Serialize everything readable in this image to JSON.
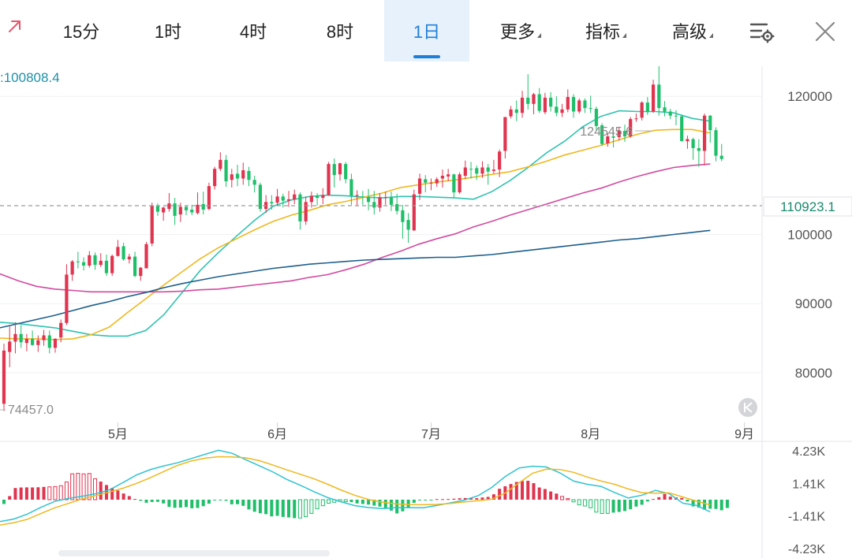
{
  "toolbar": {
    "tabs": [
      {
        "label": "15分",
        "active": false,
        "has_menu": false
      },
      {
        "label": "1时",
        "active": false,
        "has_menu": false
      },
      {
        "label": "4时",
        "active": false,
        "has_menu": false
      },
      {
        "label": "8时",
        "active": false,
        "has_menu": false
      },
      {
        "label": "1日",
        "active": true,
        "has_menu": false
      },
      {
        "label": "更多",
        "active": false,
        "has_menu": true
      },
      {
        "label": "指标",
        "active": false,
        "has_menu": true
      },
      {
        "label": "高级",
        "active": false,
        "has_menu": true
      }
    ],
    "icons": [
      "expand-arrow-icon",
      "chart-settings-icon",
      "close-icon"
    ]
  },
  "colors": {
    "accent": "#1f7fd8",
    "up": "#e0344f",
    "down": "#1fbf6a",
    "ma_teal": "#2fc3b0",
    "ma_yellow": "#f0b81e",
    "ma_pink": "#d24aa0",
    "ma_navy": "#1d5e8c"
  },
  "chart_data": {
    "type": "candlestick",
    "interval": "1日",
    "ma_readout": ":100808.4",
    "price_levels": [
      "120000",
      "100000",
      "90000",
      "80000"
    ],
    "y_range": [
      72800,
      123900
    ],
    "current_price": 110923.1,
    "current_price_label": "110923.1",
    "high_marker": {
      "label": "124545.6",
      "value": 124545.6
    },
    "low_marker": {
      "label": "74457.0",
      "value": 74457
    },
    "x_months": [
      "5月",
      "6月",
      "7月",
      "8月",
      "9月"
    ],
    "candles_ohlc": [
      [
        75500,
        84200,
        74457,
        83200
      ],
      [
        83000,
        86700,
        80800,
        84500
      ],
      [
        84500,
        87300,
        82800,
        85600
      ],
      [
        85600,
        86900,
        83600,
        84400
      ],
      [
        84300,
        85600,
        83100,
        84900
      ],
      [
        84900,
        86100,
        83900,
        84000
      ],
      [
        84000,
        85400,
        83000,
        84700
      ],
      [
        84700,
        86200,
        83900,
        85400
      ],
      [
        85400,
        86100,
        82800,
        83600
      ],
      [
        83600,
        85000,
        82900,
        84900
      ],
      [
        85100,
        87700,
        84400,
        87200
      ],
      [
        87200,
        95700,
        86900,
        94200
      ],
      [
        94200,
        96300,
        93300,
        96100
      ],
      [
        96100,
        97500,
        95100,
        96000
      ],
      [
        96000,
        96700,
        94800,
        95500
      ],
      [
        95500,
        97600,
        95200,
        97000
      ],
      [
        97000,
        97400,
        94900,
        95600
      ],
      [
        95600,
        97300,
        95300,
        96200
      ],
      [
        96200,
        97100,
        94000,
        94400
      ],
      [
        94400,
        97100,
        94000,
        96900
      ],
      [
        96900,
        99200,
        96800,
        98200
      ],
      [
        98300,
        98800,
        96200,
        96400
      ],
      [
        96400,
        97200,
        95800,
        96800
      ],
      [
        96800,
        97500,
        93800,
        94000
      ],
      [
        94000,
        95300,
        93300,
        95200
      ],
      [
        95100,
        98900,
        95100,
        98600
      ],
      [
        98700,
        104600,
        98300,
        104200
      ],
      [
        104200,
        104500,
        102700,
        103300
      ],
      [
        103200,
        104000,
        102000,
        103900
      ],
      [
        103700,
        106000,
        103300,
        104500
      ],
      [
        104500,
        105300,
        101400,
        102700
      ],
      [
        102900,
        104600,
        101800,
        104000
      ],
      [
        104000,
        104200,
        102800,
        103500
      ],
      [
        103600,
        104300,
        102800,
        103200
      ],
      [
        103100,
        106100,
        102900,
        104300
      ],
      [
        104400,
        106200,
        102900,
        103600
      ],
      [
        103700,
        107500,
        103500,
        107000
      ],
      [
        107000,
        109800,
        106500,
        109500
      ],
      [
        109500,
        111900,
        109200,
        110800
      ],
      [
        110800,
        111500,
        106900,
        107700
      ],
      [
        107900,
        109500,
        106800,
        108700
      ],
      [
        108800,
        110100,
        107000,
        108100
      ],
      [
        108100,
        110400,
        107200,
        109300
      ],
      [
        109200,
        109800,
        107000,
        107900
      ],
      [
        107900,
        108500,
        106100,
        107200
      ],
      [
        107200,
        107500,
        103300,
        103700
      ],
      [
        103700,
        105700,
        103100,
        104700
      ],
      [
        104700,
        105700,
        103600,
        104500
      ],
      [
        104600,
        106600,
        104100,
        105500
      ],
      [
        105500,
        105900,
        103900,
        104900
      ],
      [
        104900,
        106300,
        104000,
        105100
      ],
      [
        105100,
        106500,
        104400,
        105800
      ],
      [
        105800,
        106100,
        100700,
        101900
      ],
      [
        101900,
        105500,
        101400,
        104700
      ],
      [
        104700,
        106200,
        103900,
        105600
      ],
      [
        105600,
        106000,
        104200,
        105300
      ],
      [
        105300,
        106700,
        104400,
        105700
      ],
      [
        105700,
        110500,
        105600,
        110200
      ],
      [
        110200,
        111000,
        106800,
        108600
      ],
      [
        108700,
        110400,
        107800,
        110300
      ],
      [
        110200,
        110500,
        107400,
        108000
      ],
      [
        108000,
        108800,
        104300,
        105600
      ],
      [
        105600,
        106400,
        104200,
        105700
      ],
      [
        105500,
        106300,
        104300,
        105400
      ],
      [
        105400,
        106600,
        103500,
        104700
      ],
      [
        104700,
        106300,
        102900,
        103900
      ],
      [
        103900,
        106000,
        103300,
        105400
      ],
      [
        105400,
        106200,
        104300,
        105400
      ],
      [
        105400,
        106200,
        103400,
        104300
      ],
      [
        104400,
        105900,
        102900,
        103400
      ],
      [
        103500,
        104300,
        99400,
        101800
      ],
      [
        102100,
        103100,
        98800,
        100700
      ],
      [
        100600,
        106500,
        100500,
        105800
      ],
      [
        105900,
        108800,
        105000,
        108100
      ],
      [
        108000,
        108600,
        106100,
        107500
      ],
      [
        107400,
        108100,
        106400,
        107500
      ],
      [
        107400,
        108300,
        106900,
        108000
      ],
      [
        108100,
        109400,
        106800,
        108500
      ],
      [
        108400,
        109500,
        107700,
        108700
      ],
      [
        108700,
        108800,
        105300,
        106100
      ],
      [
        106100,
        109000,
        105900,
        108700
      ],
      [
        108500,
        110700,
        108000,
        109700
      ],
      [
        109500,
        110500,
        108100,
        109400
      ],
      [
        109600,
        110000,
        107900,
        108800
      ],
      [
        108800,
        110600,
        108200,
        109700
      ],
      [
        109700,
        110200,
        107200,
        109100
      ],
      [
        109200,
        110800,
        108800,
        109400
      ],
      [
        109400,
        112300,
        108300,
        112000
      ],
      [
        112100,
        116500,
        111000,
        117000
      ],
      [
        117100,
        118600,
        116800,
        118100
      ],
      [
        118100,
        119400,
        116400,
        117600
      ],
      [
        117600,
        120800,
        116900,
        119800
      ],
      [
        119800,
        123200,
        118100,
        118900
      ],
      [
        118900,
        120500,
        117400,
        120300
      ],
      [
        120300,
        121200,
        117600,
        117900
      ],
      [
        117700,
        120500,
        117400,
        119800
      ],
      [
        119800,
        120600,
        117800,
        118500
      ],
      [
        118500,
        120000,
        117100,
        117600
      ],
      [
        117600,
        118900,
        117000,
        118100
      ],
      [
        118100,
        121000,
        117700,
        119900
      ],
      [
        119900,
        120300,
        116900,
        117800
      ],
      [
        117800,
        119700,
        117500,
        119400
      ],
      [
        119400,
        119700,
        117600,
        118300
      ],
      [
        118300,
        120100,
        117600,
        118200
      ],
      [
        118200,
        118500,
        115000,
        115700
      ],
      [
        115800,
        116100,
        112800,
        113100
      ],
      [
        113200,
        114700,
        112700,
        114200
      ],
      [
        114200,
        115100,
        112600,
        114000
      ],
      [
        114100,
        115600,
        113600,
        115000
      ],
      [
        115000,
        115900,
        113400,
        114200
      ],
      [
        114200,
        117000,
        114000,
        116700
      ],
      [
        116700,
        117500,
        116300,
        116800
      ],
      [
        116900,
        119300,
        116500,
        119100
      ],
      [
        119100,
        119900,
        117300,
        117700
      ],
      [
        117800,
        122400,
        117600,
        121700
      ],
      [
        121700,
        124545,
        117200,
        118300
      ],
      [
        118400,
        119300,
        117100,
        117800
      ],
      [
        117800,
        118200,
        116700,
        117200
      ],
      [
        117200,
        118000,
        115800,
        117100
      ],
      [
        117100,
        117300,
        114000,
        113500
      ],
      [
        113500,
        114300,
        112400,
        113800
      ],
      [
        113800,
        114000,
        110800,
        112500
      ],
      [
        112500,
        113800,
        109800,
        112100
      ],
      [
        112100,
        117500,
        110000,
        117200
      ],
      [
        117200,
        117300,
        113300,
        115100
      ],
      [
        115100,
        115500,
        110600,
        111400
      ],
      [
        111400,
        113100,
        110600,
        110923
      ]
    ],
    "moving_averages": [
      {
        "color": "#2fc3b0",
        "values": [
          87300,
          87100,
          86800,
          86500,
          86000,
          85500,
          85300,
          85300,
          86100,
          88400,
          91600,
          94800,
          97400,
          99800,
          102100,
          104100,
          105000,
          105500,
          105700,
          105600,
          105400,
          105300,
          105500,
          105500,
          105400,
          105300,
          105100,
          106200,
          107800,
          109700,
          111800,
          113500,
          115600,
          117100,
          117900,
          117800,
          117800,
          117600,
          116800,
          116400
        ]
      },
      {
        "color": "#f0b81e",
        "values": [
          85000,
          84900,
          84900,
          84800,
          84900,
          85500,
          86600,
          88700,
          90700,
          92700,
          94600,
          96500,
          98100,
          99400,
          100700,
          101900,
          102800,
          103500,
          104300,
          104800,
          105400,
          106000,
          106800,
          107200,
          107600,
          107900,
          108300,
          108700,
          109100,
          109800,
          110600,
          111500,
          112200,
          112900,
          113700,
          114500,
          115100,
          115200,
          115200,
          114700
        ]
      },
      {
        "color": "#d24aa0",
        "values": [
          94300,
          93300,
          92500,
          92100,
          91900,
          91700,
          91700,
          91700,
          91700,
          91700,
          91800,
          92000,
          92100,
          92400,
          92700,
          93000,
          93300,
          93800,
          94200,
          94900,
          95700,
          96700,
          97600,
          98600,
          99400,
          100100,
          101100,
          101900,
          102800,
          103600,
          104400,
          105200,
          106000,
          106700,
          107600,
          108400,
          109100,
          109700,
          110000,
          110200
        ]
      },
      {
        "color": "#1d5e8c",
        "values": [
          86500,
          87100,
          87700,
          88300,
          89000,
          89700,
          90300,
          91000,
          91600,
          92300,
          92900,
          93400,
          93900,
          94300,
          94700,
          95100,
          95400,
          95700,
          95900,
          96100,
          96300,
          96400,
          96500,
          96600,
          96700,
          96700,
          96900,
          97100,
          97400,
          97700,
          98000,
          98300,
          98600,
          98900,
          99200,
          99400,
          99700,
          100000,
          100300,
          100600
        ]
      }
    ],
    "macd": {
      "levels": [
        "4.23K",
        "1.41K",
        "-1.41K",
        "-4.23K"
      ],
      "y_range": [
        -4230,
        4230
      ],
      "histogram": [
        -375,
        310,
        1010,
        1055,
        1065,
        1060,
        1075,
        1105,
        1110,
        1135,
        1210,
        1540,
        2240,
        2280,
        2230,
        2270,
        1815,
        1565,
        1270,
        1010,
        795,
        535,
        310,
        65,
        -100,
        -265,
        -200,
        -185,
        -325,
        -625,
        -705,
        -685,
        -645,
        -745,
        -720,
        -565,
        -345,
        -60,
        -25,
        -95,
        -400,
        -390,
        -535,
        -845,
        -1045,
        -1175,
        -1255,
        -1445,
        -1400,
        -1495,
        -1540,
        -1600,
        -1590,
        -1465,
        -1185,
        -790,
        -525,
        -310,
        -230,
        -155,
        -175,
        -210,
        -325,
        -375,
        -425,
        -515,
        -600,
        -725,
        -945,
        -1190,
        -1010,
        -715,
        -270,
        -70,
        -40,
        -3,
        50,
        45,
        55,
        85,
        125,
        145,
        165,
        130,
        190,
        240,
        465,
        945,
        1160,
        1355,
        1535,
        1615,
        1635,
        1430,
        1055,
        925,
        710,
        530,
        285,
        90,
        -190,
        -450,
        -545,
        -705,
        -1075,
        -1195,
        -1185,
        -1120,
        -1065,
        -985,
        -830,
        -600,
        -440,
        -150,
        55,
        215,
        495,
        265,
        200,
        150,
        -155,
        -585,
        -690,
        -865,
        -780,
        -800,
        -920,
        -720
      ],
      "dif": [
        -1900,
        -1680,
        -1250,
        -660,
        -150,
        110,
        290,
        515,
        845,
        1480,
        2140,
        2600,
        2930,
        3190,
        3560,
        3920,
        4280,
        4010,
        3460,
        2930,
        2390,
        1750,
        1240,
        690,
        180,
        -200,
        -520,
        -680,
        -770,
        -690,
        -690,
        -700,
        -500,
        -270,
        -40,
        340,
        1060,
        2010,
        2740,
        2900,
        2830,
        2320,
        1610,
        1330,
        1150,
        620,
        140,
        390,
        810,
        520,
        -310,
        -500,
        -1060
      ],
      "dea": [
        -2200,
        -2000,
        -1700,
        -1200,
        -700,
        -330,
        60,
        350,
        660,
        990,
        1410,
        1900,
        2440,
        2970,
        3350,
        3590,
        3720,
        3700,
        3620,
        3380,
        2990,
        2580,
        2200,
        1800,
        1330,
        820,
        370,
        10,
        -220,
        -370,
        -420,
        -440,
        -410,
        -330,
        -200,
        -90,
        40,
        580,
        1460,
        2290,
        2640,
        2610,
        2370,
        1960,
        1620,
        1330,
        930,
        610,
        560,
        590,
        230,
        -130,
        -460
      ]
    }
  }
}
